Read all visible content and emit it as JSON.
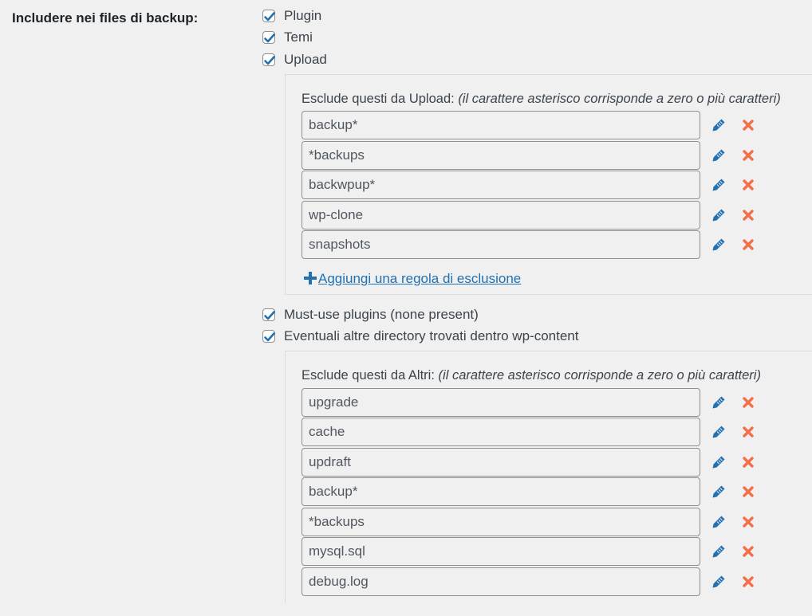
{
  "section": {
    "label": "Includere nei files di backup:"
  },
  "options": [
    {
      "label": "Plugin",
      "checked": true
    },
    {
      "label": "Temi",
      "checked": true
    },
    {
      "label": "Upload",
      "checked": true
    },
    {
      "label": "Must-use plugins (none present)",
      "checked": true
    },
    {
      "label": "Eventuali altre directory trovati dentro wp-content",
      "checked": true
    }
  ],
  "uploads_exclusions": {
    "title": "Esclude questi da Upload:",
    "hint": "(il carattere asterisco corrisponde a zero o più caratteri)",
    "rules": [
      "backup*",
      "*backups",
      "backwpup*",
      "wp-clone",
      "snapshots"
    ],
    "add_label": "Aggiungi una regola di esclusione"
  },
  "others_exclusions": {
    "title": "Esclude questi da Altri:",
    "hint": "(il carattere asterisco corrisponde a zero o più caratteri)",
    "rules": [
      "upgrade",
      "cache",
      "updraft",
      "backup*",
      "*backups",
      "mysql.sql",
      "debug.log"
    ]
  },
  "icons": {
    "edit": "pencil-icon",
    "delete": "x-icon",
    "add": "plus-icon",
    "check": "checkmark-icon"
  },
  "colors": {
    "accent": "#2271b1",
    "delete": "#f56e47",
    "background": "#f0f0f1"
  }
}
